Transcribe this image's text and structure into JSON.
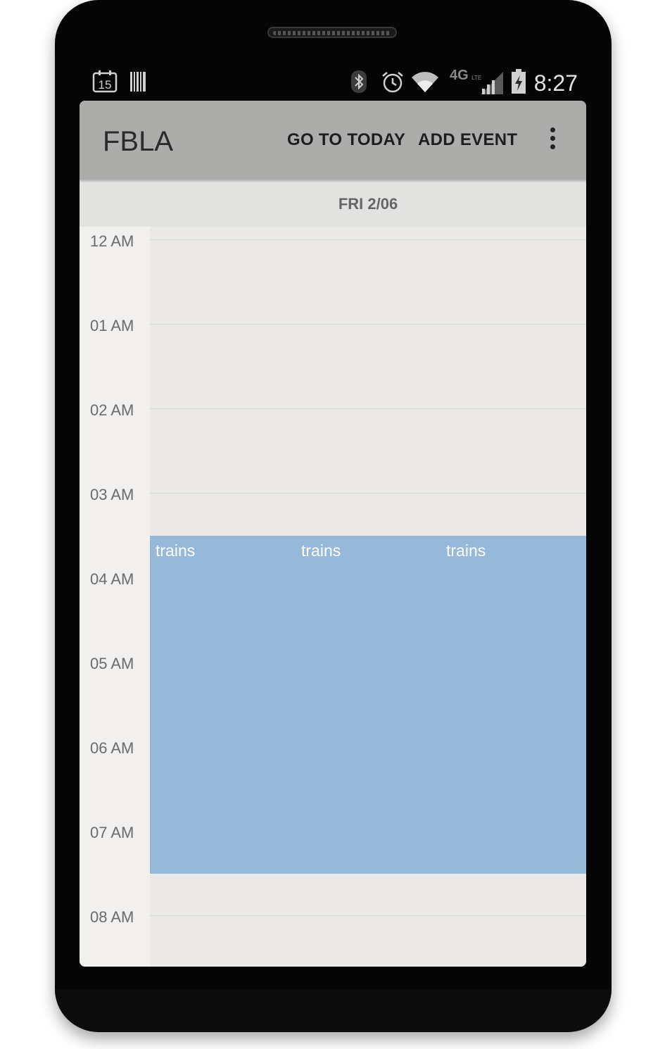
{
  "status_bar": {
    "icons": [
      "calendar-15-icon",
      "barcode-icon",
      "bluetooth-icon",
      "alarm-icon",
      "wifi-icon",
      "4g-lte-icon",
      "signal-icon",
      "battery-charging-icon"
    ],
    "calendar_day": "15",
    "network": "4G",
    "time": "8:27"
  },
  "action_bar": {
    "title": "FBLA",
    "go_to_today": "GO TO TODAY",
    "add_event": "ADD EVENT",
    "overflow_icon": "overflow-menu-icon"
  },
  "day_view": {
    "date_label": "FRI 2/06",
    "hours": [
      "12 AM",
      "01 AM",
      "02 AM",
      "03 AM",
      "04 AM",
      "05 AM",
      "06 AM",
      "07 AM",
      "08 AM"
    ],
    "events": [
      {
        "title": "trains"
      },
      {
        "title": "trains"
      },
      {
        "title": "trains"
      }
    ],
    "event_color": "#97b9d9"
  }
}
